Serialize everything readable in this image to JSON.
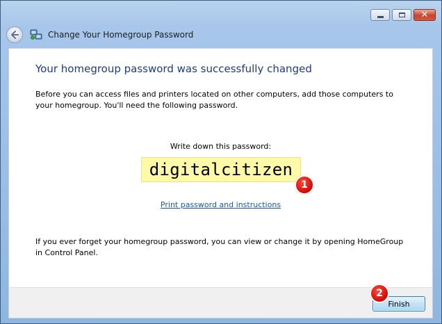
{
  "window": {
    "title": "Change Your Homegroup Password",
    "caption_buttons": {
      "minimize": "minimize-icon",
      "maximize": "maximize-icon",
      "close": "close-icon",
      "close_glyph": "✕"
    }
  },
  "main": {
    "heading": "Your homegroup password was successfully changed",
    "intro": "Before you can access files and printers located on other computers, add those computers to your homegroup. You'll need the following password.",
    "password_label": "Write down this password:",
    "password": "digitalcitizen",
    "print_link": "Print password and instructions",
    "forget_text": "If you ever forget your homegroup password, you can view or change it by opening HomeGroup in Control Panel."
  },
  "footer": {
    "finish_label": "Finish"
  },
  "annotations": {
    "marker_1": "1",
    "marker_2": "2"
  },
  "colors": {
    "heading": "#1c3b8a",
    "link": "#1a5aa6",
    "password_highlight": "#fff9a8",
    "marker": "#d10f0a"
  }
}
